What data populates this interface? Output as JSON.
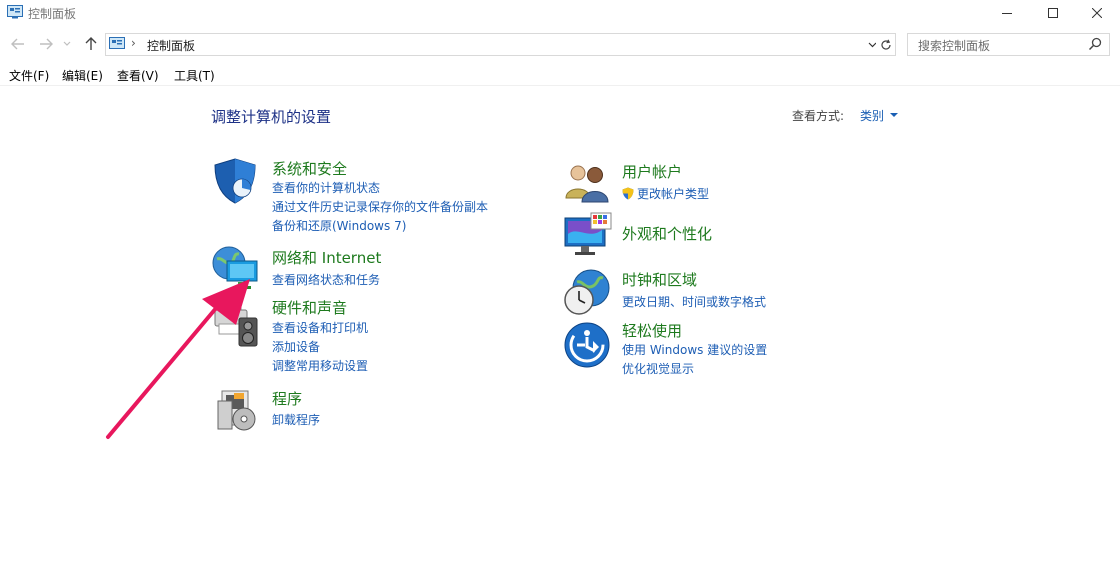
{
  "window": {
    "title": "控制面板"
  },
  "address": {
    "path": "控制面板",
    "separator": "›"
  },
  "search": {
    "placeholder": "搜索控制面板"
  },
  "menu": [
    "文件(F)",
    "编辑(E)",
    "查看(V)",
    "工具(T)"
  ],
  "main": {
    "title": "调整计算机的设置",
    "view_by_label": "查看方式:",
    "view_by_value": "类别"
  },
  "categories": {
    "system": {
      "title": "系统和安全",
      "links": [
        "查看你的计算机状态",
        "通过文件历史记录保存你的文件备份副本",
        "备份和还原(Windows 7)"
      ]
    },
    "network": {
      "title": "网络和 Internet",
      "links": [
        "查看网络状态和任务"
      ]
    },
    "hardware": {
      "title": "硬件和声音",
      "links": [
        "查看设备和打印机",
        "添加设备",
        "调整常用移动设置"
      ]
    },
    "programs": {
      "title": "程序",
      "links": [
        "卸载程序"
      ]
    },
    "users": {
      "title": "用户帐户",
      "links": [
        "更改帐户类型"
      ]
    },
    "appearance": {
      "title": "外观和个性化",
      "links": []
    },
    "clock": {
      "title": "时钟和区域",
      "links": [
        "更改日期、时间或数字格式"
      ]
    },
    "ease": {
      "title": "轻松使用",
      "links": [
        "使用 Windows 建议的设置",
        "优化视觉显示"
      ]
    }
  },
  "colors": {
    "category_title": "#1e7a1e",
    "link": "#1e5eb4",
    "page_title": "#1e3287",
    "annotation_arrow": "#e8175d"
  }
}
